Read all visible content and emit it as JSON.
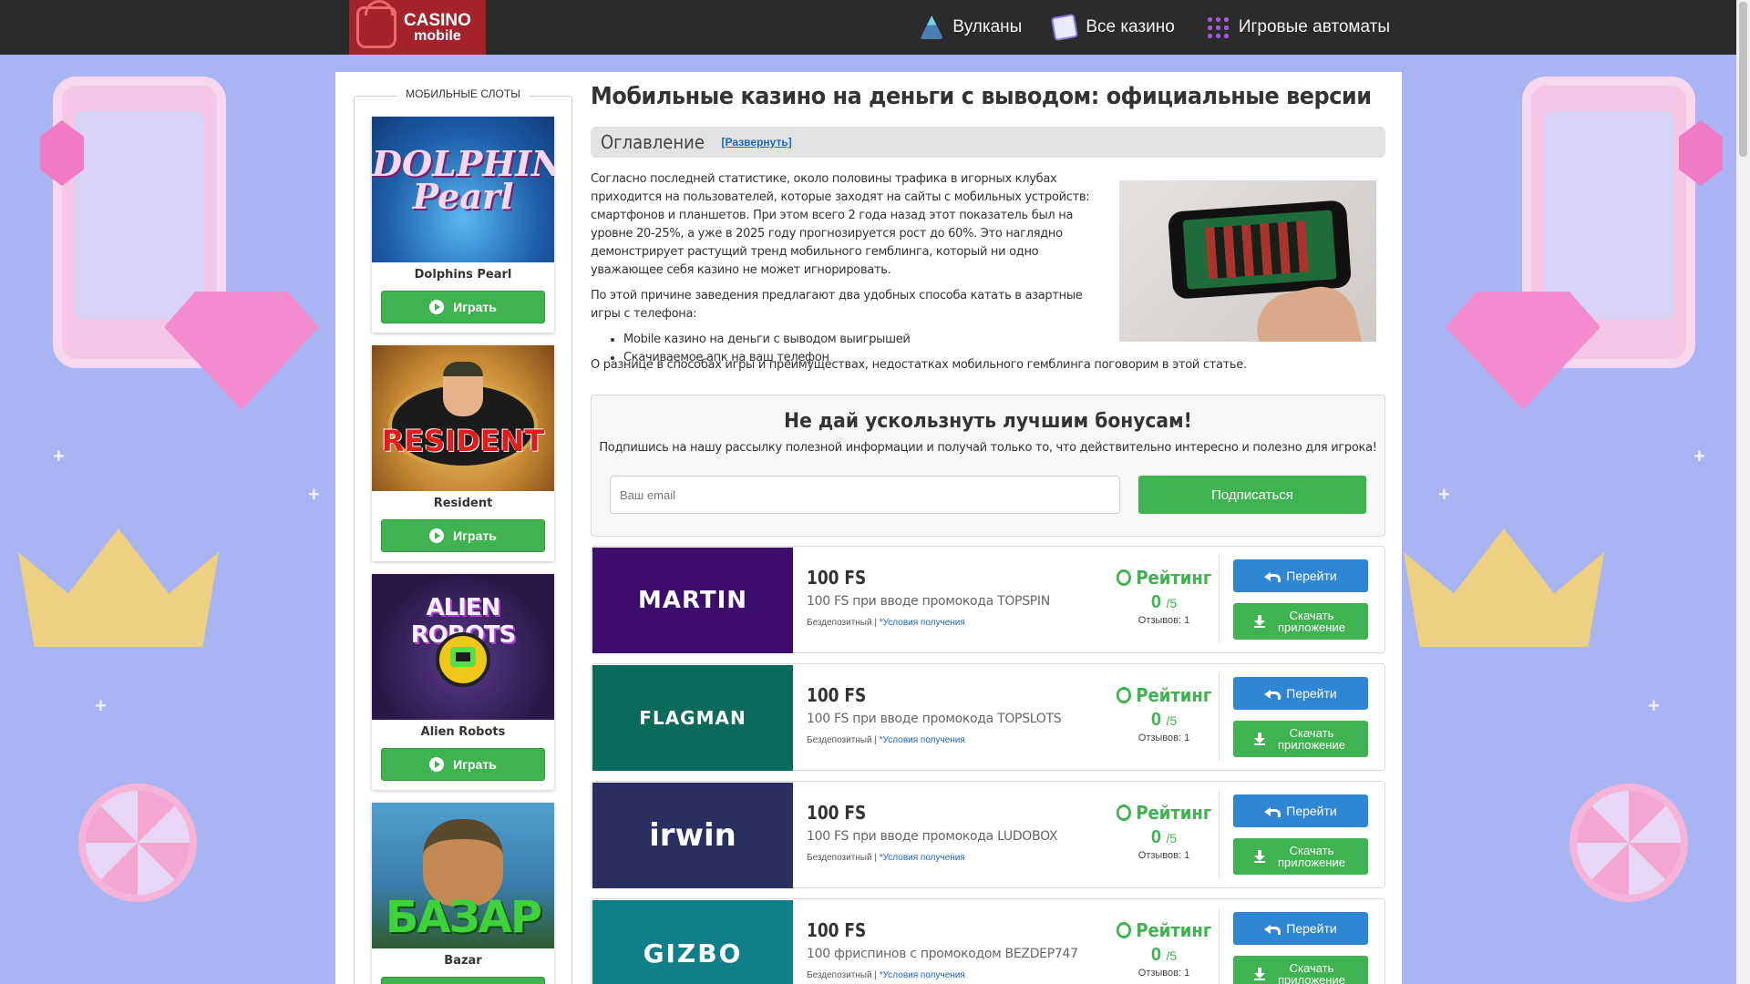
{
  "header": {
    "logo_line1": "CASINO",
    "logo_line2": "mobile",
    "nav": [
      {
        "label": "Вулканы",
        "icon": "volcano-icon"
      },
      {
        "label": "Все казино",
        "icon": "cards-icon"
      },
      {
        "label": "Игровые автоматы",
        "icon": "grapes-icon"
      }
    ]
  },
  "sidebar": {
    "title": "МОБИЛЬНЫЕ СЛОТЫ",
    "play_label": "Играть",
    "slots": [
      {
        "name": "Dolphins Pearl",
        "art_text": "DOLPHIN'S Pearl"
      },
      {
        "name": "Resident",
        "art_text": "RESIDENT"
      },
      {
        "name": "Alien Robots",
        "art_text": "ALIEN ROBOTS"
      },
      {
        "name": "Bazar",
        "art_text": "БАЗАР"
      }
    ]
  },
  "article": {
    "title": "Мобильные казино на деньги с выводом: официальные версии",
    "toc_title": "Оглавление",
    "toc_toggle": "[Развернуть]",
    "p1": "Согласно последней статистике, около половины трафика в игорных клубах приходится на пользователей, которые заходят на сайты с мобильных устройств: смартфонов и планшетов. При этом всего 2 года назад этот показатель был на уровне 20-25%, а уже в 2025 году прогнозируется рост до 60%. Это наглядно демонстрирует растущий тренд мобильного гемблинга, который ни одно уважающее себя казино не может игнорировать.",
    "p2": "По этой причине заведения предлагают два удобных способа катать в азартные игры с телефона:",
    "list": [
      "Mobile казино на деньги с выводом выигрышей",
      "Скачиваемое апк на ваш телефон"
    ],
    "p3": "О разнице в способах игры и преимуществах, недостатках мобильного гемблинга поговорим в этой статье."
  },
  "subscribe": {
    "title": "Не дай ускользнуть лучшим бонусам!",
    "text": "Подпишись на нашу рассылку полезной информации и получай только то, что действительно интересно и полезно для игрока!",
    "placeholder": "Ваш email",
    "button": "Подписаться"
  },
  "cards_common": {
    "rating_label": "Рейтинг",
    "score_max": "/5",
    "go_label": "Перейти",
    "download_label": "Скачать приложение",
    "nodeposit": "Бездепозитный |",
    "terms": "*Условия получения"
  },
  "casinos": [
    {
      "brand": "MARTIN",
      "bg": "#3d0d6e",
      "bonus": "100 FS",
      "desc": "100 FS при вводе промокода TOPSPIN",
      "score": "0",
      "reviews": "Отзывов: 1"
    },
    {
      "brand": "FLAGMAN",
      "bg": "#0b6b5a",
      "bonus": "100 FS",
      "desc": "100 FS при вводе промокода TOPSLOTS",
      "score": "0",
      "reviews": "Отзывов: 1"
    },
    {
      "brand": "irwin",
      "bg": "#2a2f62",
      "bonus": "100 FS",
      "desc": "100 FS при вводе промокода LUDOBOX",
      "score": "0",
      "reviews": "Отзывов: 1"
    },
    {
      "brand": "GIZBO",
      "bg": "#0f7f8a",
      "bonus": "100 FS",
      "desc": "100 фриспинов с промокодом BEZDEP747",
      "score": "0",
      "reviews": "Отзывов: 1"
    }
  ],
  "colors": {
    "header_bg": "#2b2b2b",
    "logo_bg": "#a3222c",
    "accent_green": "#3fb34f",
    "accent_blue": "#2f86d4",
    "page_bg": "#a9b4f3"
  }
}
